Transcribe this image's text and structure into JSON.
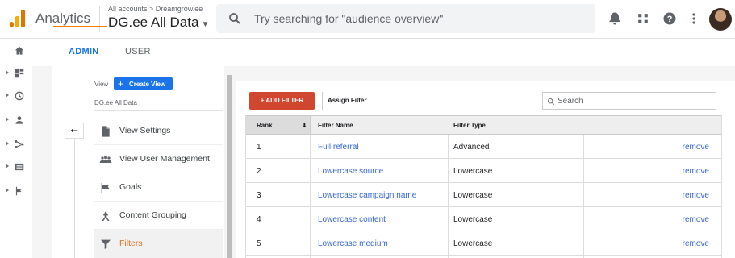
{
  "header": {
    "app_title": "Analytics",
    "breadcrumb": "All accounts > Dreamgrow.ee",
    "account": "DG.ee All Data",
    "search_placeholder": "Try searching for \"audience overview\""
  },
  "tabs": [
    {
      "label": "ADMIN"
    },
    {
      "label": "USER"
    }
  ],
  "view_panel": {
    "view_label": "View",
    "create_view": "Create View",
    "view_name": "DG.ee All Data",
    "menu": [
      {
        "label": "View Settings",
        "icon": "document-icon"
      },
      {
        "label": "View User Management",
        "icon": "people-icon"
      },
      {
        "label": "Goals",
        "icon": "flag-icon"
      },
      {
        "label": "Content Grouping",
        "icon": "content-grouping-icon"
      },
      {
        "label": "Filters",
        "icon": "filter-icon"
      }
    ]
  },
  "filters": {
    "add_filter": "+ ADD FILTER",
    "assign_order": "Assign Filter Order",
    "search_placeholder": "Search",
    "columns": [
      "Rank",
      "Filter Name",
      "Filter Type"
    ],
    "rows": [
      {
        "rank": "1",
        "name": "Full referral",
        "type": "Advanced",
        "action": "remove"
      },
      {
        "rank": "2",
        "name": "Lowercase source",
        "type": "Lowercase",
        "action": "remove"
      },
      {
        "rank": "3",
        "name": "Lowercase campaign name",
        "type": "Lowercase",
        "action": "remove"
      },
      {
        "rank": "4",
        "name": "Lowercase content",
        "type": "Lowercase",
        "action": "remove"
      },
      {
        "rank": "5",
        "name": "Lowercase medium",
        "type": "Lowercase",
        "action": "remove"
      }
    ]
  },
  "colors": {
    "accent_blue": "#1a73e8",
    "add_filter_red": "#d0462f",
    "active_orange": "#e8711a",
    "tab_underline": "#f57c00"
  }
}
